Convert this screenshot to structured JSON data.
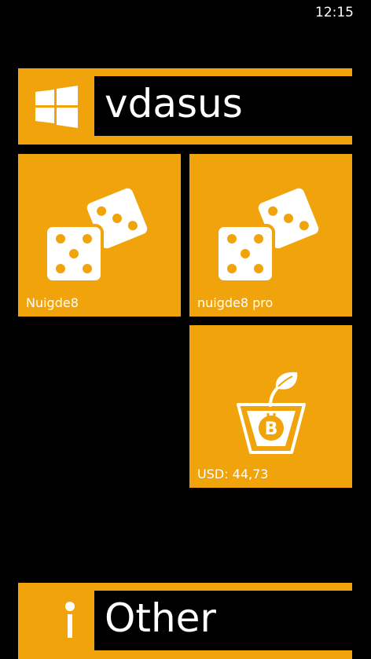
{
  "status_bar": {
    "time": "12:15"
  },
  "colors": {
    "accent": "#f0a30a",
    "background": "#000000",
    "text": "#ffffff"
  },
  "header_top": {
    "title": "vdasus",
    "icon": "windows-logo-icon"
  },
  "tiles": [
    {
      "label": "Nuigde8",
      "icon": "dice-icon"
    },
    {
      "label": "nuigde8 pro",
      "icon": "dice-icon"
    },
    {
      "label": "USD: 44,73",
      "icon": "bitcoin-plant-icon"
    }
  ],
  "header_bottom": {
    "title": "Other",
    "icon": "info-icon"
  }
}
